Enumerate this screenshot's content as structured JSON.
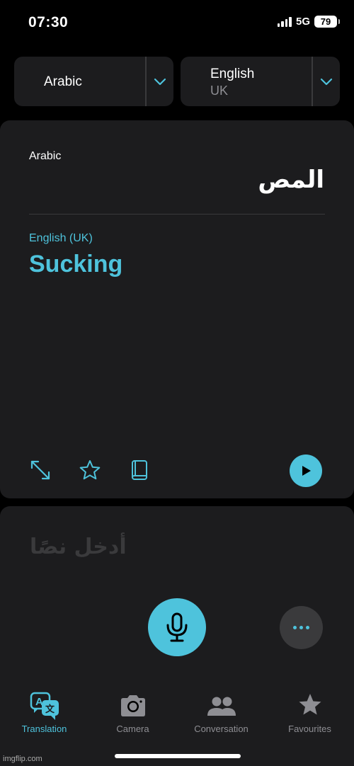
{
  "status_bar": {
    "time": "07:30",
    "network": "5G",
    "battery": "79"
  },
  "language_selector": {
    "source": {
      "label": "Arabic"
    },
    "target": {
      "label": "English",
      "sublabel": "UK"
    }
  },
  "translation_card": {
    "source_language": "Arabic",
    "source_text": "المص",
    "target_language": "English (UK)",
    "target_text": "Sucking"
  },
  "input": {
    "placeholder": "أدخل نصًا"
  },
  "tabs": [
    {
      "label": "Translation",
      "icon": "translate-icon",
      "active": true
    },
    {
      "label": "Camera",
      "icon": "camera-icon",
      "active": false
    },
    {
      "label": "Conversation",
      "icon": "people-icon",
      "active": false
    },
    {
      "label": "Favourites",
      "icon": "star-icon",
      "active": false
    }
  ],
  "watermark": "imgflip.com",
  "colors": {
    "accent": "#4ec3dc",
    "card": "#1c1c1e",
    "background": "#000000",
    "muted": "#8e8e93"
  }
}
